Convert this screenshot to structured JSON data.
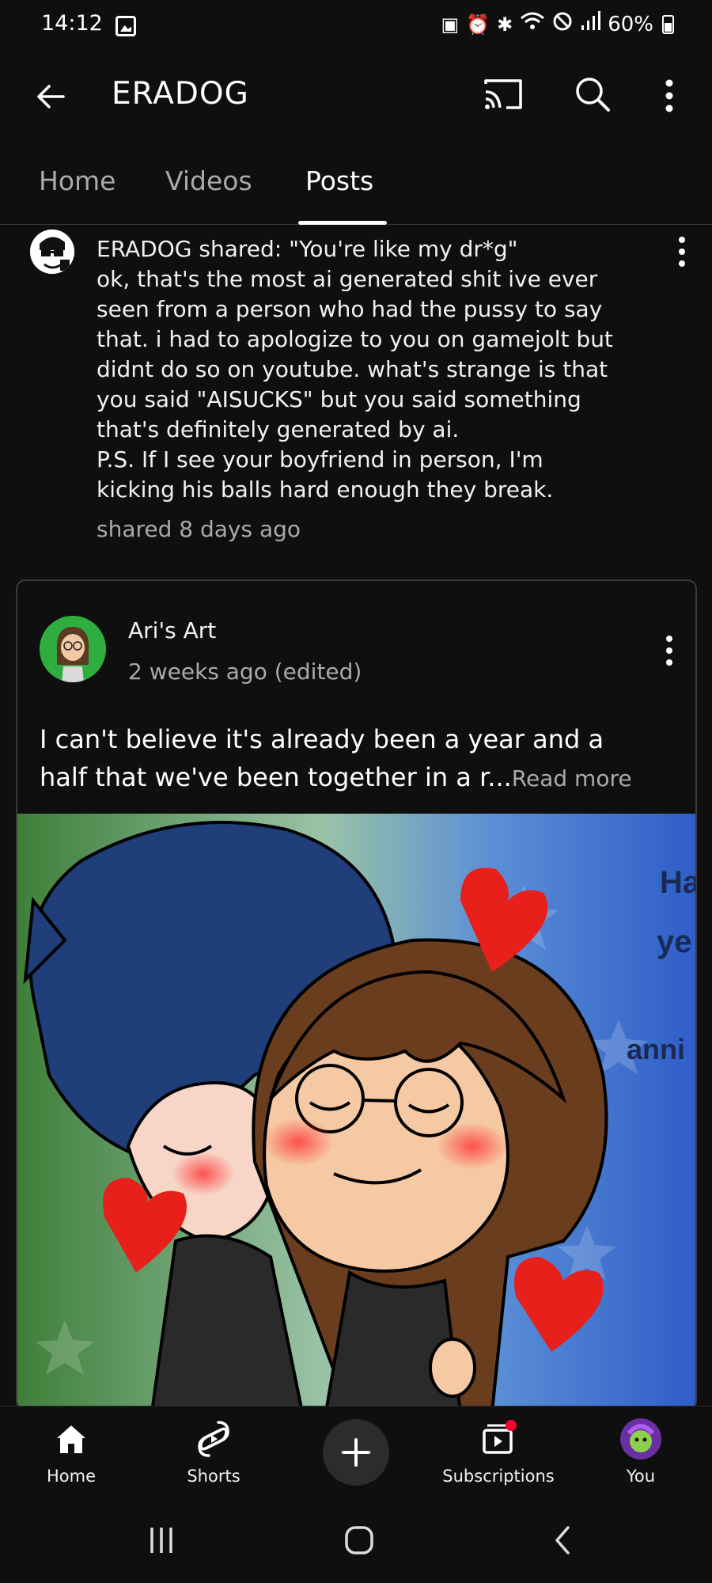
{
  "status_bar": {
    "time": "14:12",
    "battery": "60%",
    "icons": [
      "gallery-icon",
      "data-saver-icon",
      "alarm-icon",
      "bluetooth-icon",
      "wifi-icon",
      "do-not-disturb-icon",
      "signal-icon",
      "battery-icon"
    ]
  },
  "app_bar": {
    "title": "ERADOG",
    "icons": [
      "back-arrow-icon",
      "cast-icon",
      "search-icon",
      "more-vert-icon"
    ]
  },
  "tabs": [
    {
      "label": "Home",
      "active": false
    },
    {
      "label": "Videos",
      "active": false
    },
    {
      "label": "Posts",
      "active": true
    }
  ],
  "shared_post": {
    "author_line": "ERADOG shared: \"You're like my dr*g\"",
    "lines": [
      "ok, that's the most ai generated shit ive ever",
      "seen from a person who had the pussy to say",
      "that. i had to apologize to you on gamejolt but",
      "didnt do so on youtube. what's strange is that",
      "you said \"AISUCKS\" but you said something",
      "that's definitely generated by ai.",
      "P.S. If I see your boyfriend in person, I'm",
      "kicking his balls hard enough they break."
    ],
    "time": "shared 8 days ago"
  },
  "community_post": {
    "author": "Ari's Art",
    "time": "2 weeks ago (edited)",
    "text_line1": "I can't believe it's already been a year and a",
    "text_line2": "half that we've been together in a r...",
    "read_more": "Read more",
    "image_text": [
      "Ha",
      "ye",
      "anni"
    ]
  },
  "bottom_nav": {
    "items": [
      {
        "label": "Home",
        "icon": "home-icon"
      },
      {
        "label": "Shorts",
        "icon": "shorts-icon"
      },
      {
        "label": "",
        "icon": "create-plus-icon"
      },
      {
        "label": "Subscriptions",
        "icon": "subscriptions-icon"
      },
      {
        "label": "You",
        "icon": "profile-avatar"
      }
    ]
  },
  "colors": {
    "background": "#0f0f0f",
    "text_primary": "#f1f1f1",
    "text_secondary": "#aaaaaa",
    "notification_dot": "#ff0033",
    "heart_red": "#e8201c"
  }
}
